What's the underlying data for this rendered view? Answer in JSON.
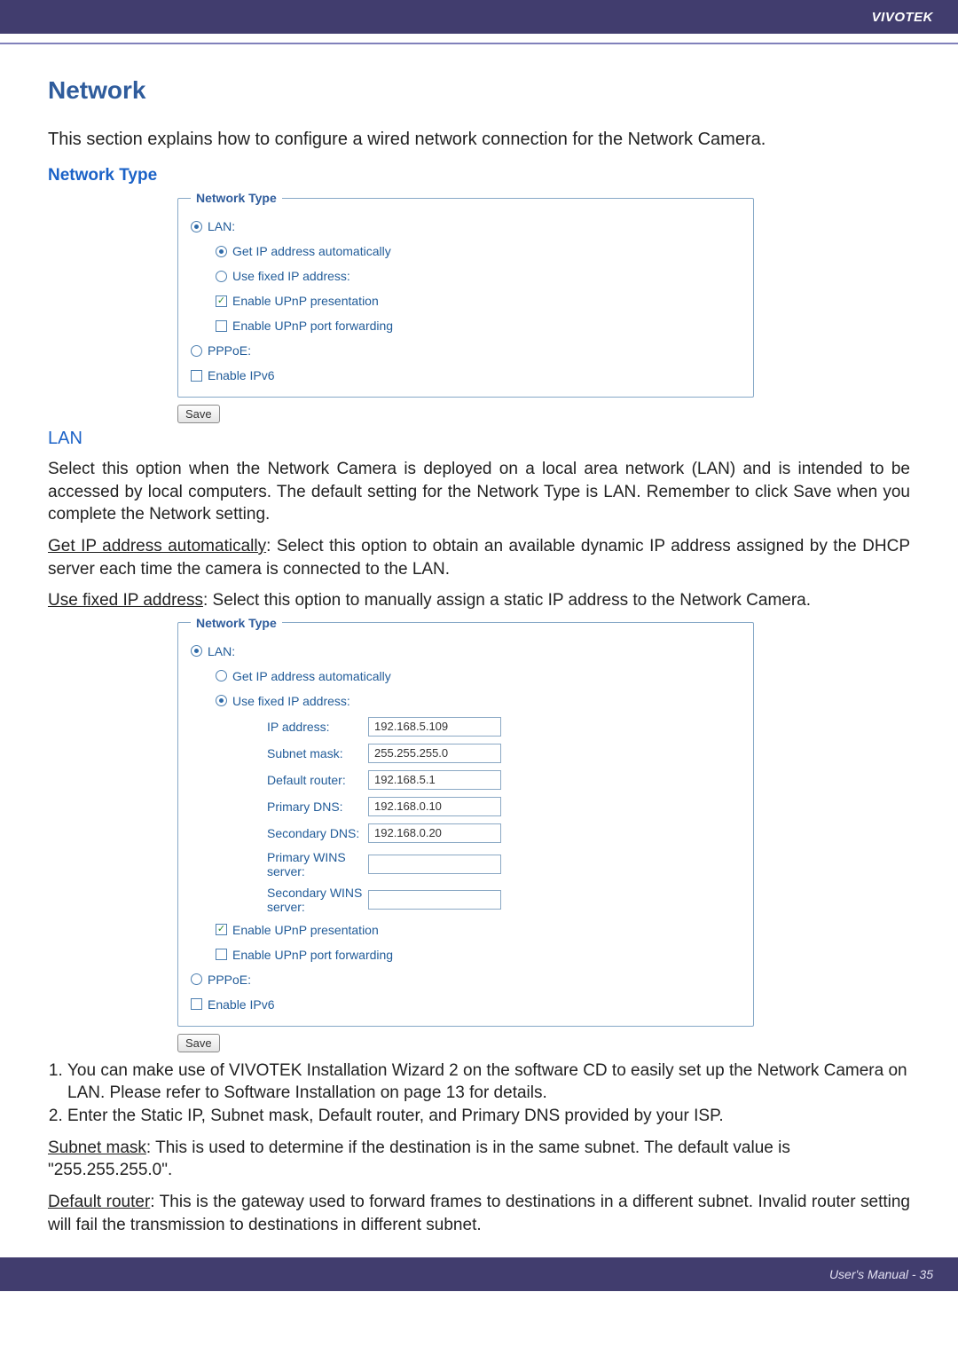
{
  "header": {
    "brand": "VIVOTEK"
  },
  "title": "Network",
  "intro": "This section explains how to configure a wired network connection for the Network Camera.",
  "networkTypeHeading": "Network Type",
  "legend": "Network Type",
  "opts": {
    "lan": "LAN:",
    "getIpAuto": "Get IP address automatically",
    "useFixedIp": "Use fixed IP address:",
    "enableUpnpPres": "Enable UPnP presentation",
    "enableUpnpFwd": "Enable UPnP port forwarding",
    "pppoe": "PPPoE:",
    "enableIpv6": "Enable IPv6"
  },
  "saveLabel": "Save",
  "lanHeading": "LAN",
  "lanPara": "Select this option when the Network Camera is deployed on a local area network (LAN) and is intended to be accessed by local computers. The default setting for the Network Type is LAN. Remember to click Save when you complete the Network setting.",
  "getIpAutoLabel": "Get IP address automatically",
  "getIpAutoPara": ": Select this option to obtain an available dynamic IP address assigned by the DHCP server each time the camera is connected to the LAN.",
  "useFixedIpLabel": "Use fixed IP address",
  "useFixedIpPara": ": Select this option to manually assign a static IP address to the Network Camera.",
  "fields": {
    "ipAddressLabel": "IP address:",
    "ipAddressValue": "192.168.5.109",
    "subnetMaskLabel": "Subnet mask:",
    "subnetMaskValue": "255.255.255.0",
    "defaultRouterLabel": "Default router:",
    "defaultRouterValue": "192.168.5.1",
    "primaryDnsLabel": "Primary DNS:",
    "primaryDnsValue": "192.168.0.10",
    "secondaryDnsLabel": "Secondary DNS:",
    "secondaryDnsValue": "192.168.0.20",
    "primaryWinsLabel": "Primary WINS server:",
    "primaryWinsValue": "",
    "secondaryWinsLabel": "Secondary WINS server:",
    "secondaryWinsValue": ""
  },
  "numbered": {
    "item1": "You can make use of VIVOTEK Installation Wizard 2 on the software CD to easily set up the Network Camera on LAN. Please refer to Software Installation on page 13 for details.",
    "item2": "Enter the Static IP, Subnet mask, Default router, and Primary DNS provided by your ISP."
  },
  "subnetMaskTermLabel": "Subnet mask",
  "subnetMaskTermPara": ": This is used to determine if the destination is in the same subnet. The default value is \"255.255.255.0\".",
  "defaultRouterTermLabel": "Default router",
  "defaultRouterTermPara": ": This is the gateway used to forward frames to destinations in a different subnet. Invalid router setting will fail the transmission to destinations in different subnet.",
  "footer": "User's Manual - 35"
}
